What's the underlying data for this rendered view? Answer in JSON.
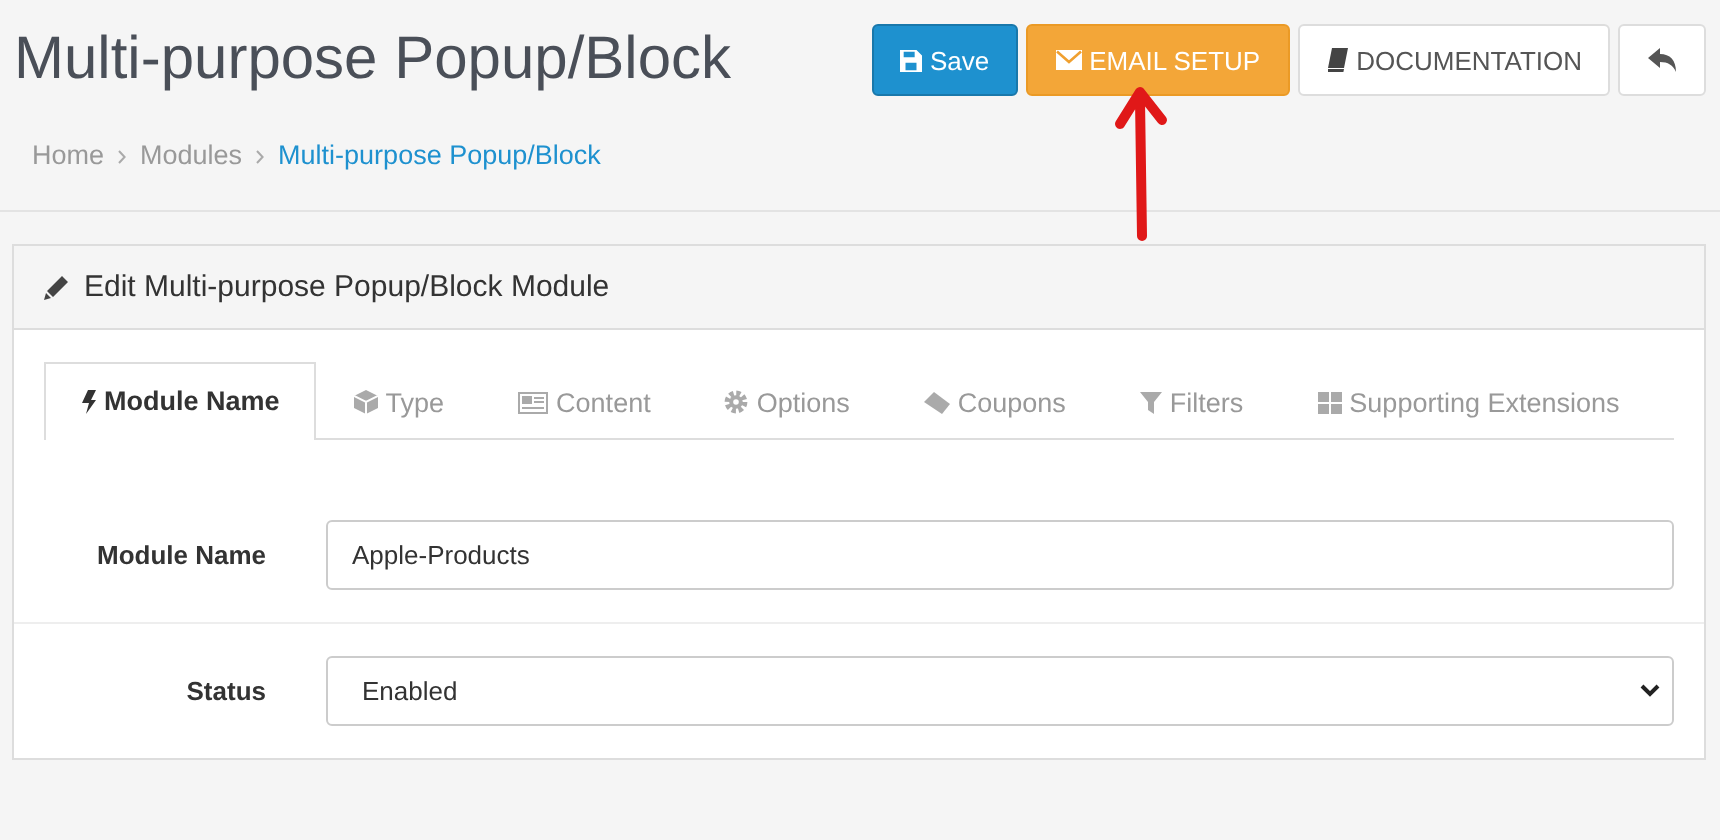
{
  "page": {
    "title": "Multi-purpose Popup/Block"
  },
  "buttons": [
    {
      "kind": "save",
      "label": "Save"
    },
    {
      "kind": "email",
      "label": "EMAIL SETUP"
    },
    {
      "kind": "docs",
      "label": "DOCUMENTATION"
    },
    {
      "kind": "back"
    }
  ],
  "breadcrumb": [
    {
      "label": "Home",
      "selected": false
    },
    {
      "label": "Modules",
      "selected": false
    },
    {
      "label": "Multi-purpose Popup/Block",
      "selected": true
    }
  ],
  "panel": {
    "title": "Edit Multi-purpose Popup/Block Module"
  },
  "tabs": [
    {
      "kind": "bolt",
      "label": "Module Name",
      "selected": true
    },
    {
      "kind": "cube",
      "label": "Type",
      "selected": false
    },
    {
      "kind": "news",
      "label": "Content",
      "selected": false
    },
    {
      "kind": "gear",
      "label": "Options",
      "selected": false
    },
    {
      "kind": "ticket",
      "label": "Coupons",
      "selected": false
    },
    {
      "kind": "filter",
      "label": "Filters",
      "selected": false
    },
    {
      "kind": "grid",
      "label": "Supporting Extensions",
      "selected": false
    }
  ],
  "form": [
    {
      "kind": "text",
      "label": "Module Name",
      "value": "Apple-Products"
    },
    {
      "kind": "select",
      "label": "Status",
      "value": "Enabled"
    }
  ]
}
